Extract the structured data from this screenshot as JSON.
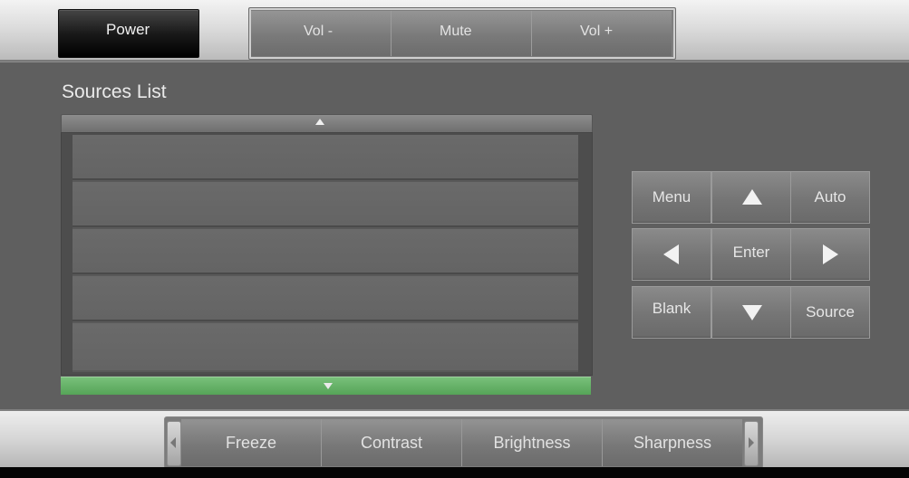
{
  "topbar": {
    "power_label": "Power",
    "volume": [
      {
        "label": "Vol -"
      },
      {
        "label": "Mute"
      },
      {
        "label": "Vol +"
      }
    ]
  },
  "sources": {
    "title": "Sources List",
    "rows": [
      "",
      "",
      "",
      "",
      ""
    ]
  },
  "keypad": {
    "menu": "Menu",
    "auto": "Auto",
    "enter": "Enter",
    "blank": "Blank",
    "source": "Source"
  },
  "adjust": {
    "buttons": [
      {
        "label": "Freeze"
      },
      {
        "label": "Contrast"
      },
      {
        "label": "Brightness"
      },
      {
        "label": "Sharpness"
      }
    ]
  },
  "colors": {
    "scroll_active": "#5cad5e",
    "power_bg": "#1a1a1a",
    "panel_bg": "#5f5f5f"
  },
  "icons": [
    "chevron-up-icon",
    "chevron-down-icon",
    "arrow-up-icon",
    "arrow-down-icon",
    "arrow-left-icon",
    "arrow-right-icon",
    "scroll-left-icon",
    "scroll-right-icon"
  ]
}
